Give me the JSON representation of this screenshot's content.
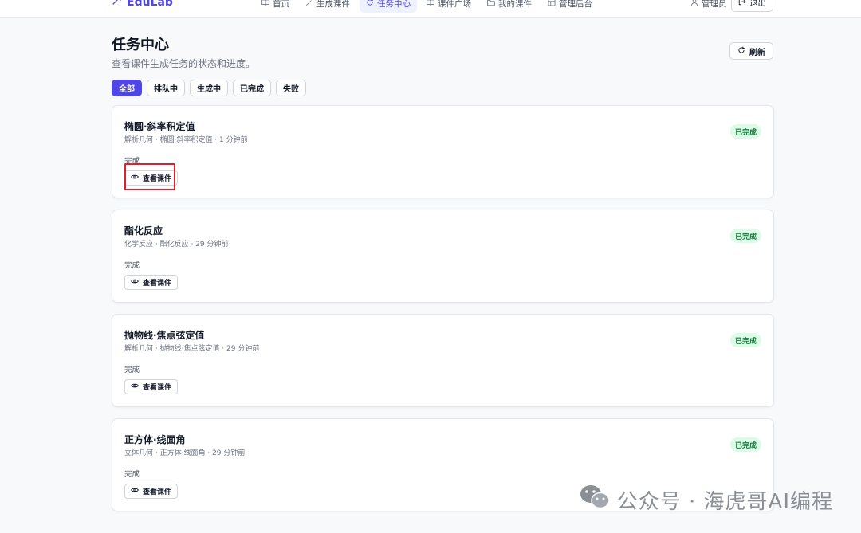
{
  "brand": {
    "name": "EduLab"
  },
  "nav": {
    "items": [
      {
        "label": "首页",
        "icon": "book-icon"
      },
      {
        "label": "生成课件",
        "icon": "wand-icon"
      },
      {
        "label": "任务中心",
        "icon": "refresh-icon",
        "active": true
      },
      {
        "label": "课件广场",
        "icon": "book-icon"
      },
      {
        "label": "我的课件",
        "icon": "folder-icon"
      },
      {
        "label": "管理后台",
        "icon": "dashboard-icon"
      }
    ],
    "user_label": "管理员",
    "logout_label": "退出"
  },
  "header": {
    "title": "任务中心",
    "subtitle": "查看课件生成任务的状态和进度。",
    "refresh_label": "刷新"
  },
  "filters": {
    "all": "全部",
    "queued": "排队中",
    "generating": "生成中",
    "completed": "已完成",
    "failed": "失败"
  },
  "tasks": [
    {
      "title": "椭圆·斜率积定值",
      "meta": "解析几何 · 椭圆·斜率积定值 · 1 分钟前",
      "status_text": "完成",
      "badge": "已完成",
      "action": "查看课件"
    },
    {
      "title": "酯化反应",
      "meta": "化学反应 · 酯化反应 · 29 分钟前",
      "status_text": "完成",
      "badge": "已完成",
      "action": "查看课件"
    },
    {
      "title": "抛物线·焦点弦定值",
      "meta": "解析几何 · 抛物线·焦点弦定值 · 29 分钟前",
      "status_text": "完成",
      "badge": "已完成",
      "action": "查看课件"
    },
    {
      "title": "正方体·线面角",
      "meta": "立体几何 · 正方体·线面角 · 29 分钟前",
      "status_text": "完成",
      "badge": "已完成",
      "action": "查看课件"
    }
  ],
  "watermark": {
    "text": "公众号 · 海虎哥AI编程"
  },
  "colors": {
    "accent": "#4f46e5",
    "success_text": "#15803d",
    "success_bg": "#dcfce7",
    "highlight": "#e11d2e"
  }
}
